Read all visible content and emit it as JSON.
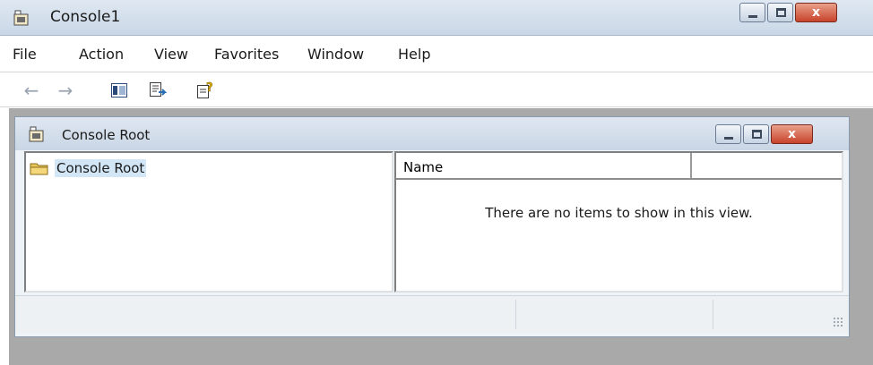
{
  "window": {
    "title": "Console1",
    "controls": {
      "close_glyph": "x"
    }
  },
  "menubar": {
    "items": [
      "File",
      "Action",
      "View",
      "Favorites",
      "Window",
      "Help"
    ]
  },
  "toolbar": {
    "buttons": [
      "back-arrow-icon",
      "forward-arrow-icon",
      "show-hide-console-tree-icon",
      "export-list-icon",
      "help-icon"
    ]
  },
  "child_window": {
    "title": "Console Root",
    "controls": {
      "close_glyph": "x"
    },
    "tree": {
      "items": [
        {
          "label": "Console Root",
          "icon": "folder-icon",
          "selected": true
        }
      ]
    },
    "list": {
      "columns": [
        "Name",
        ""
      ],
      "empty_message": "There are no items to show in this view."
    }
  },
  "colors": {
    "title_bar": "#c9d7e6",
    "close_button": "#c8432b",
    "mdi_background": "#a9a9a9",
    "selection": "#d2e6f6"
  }
}
